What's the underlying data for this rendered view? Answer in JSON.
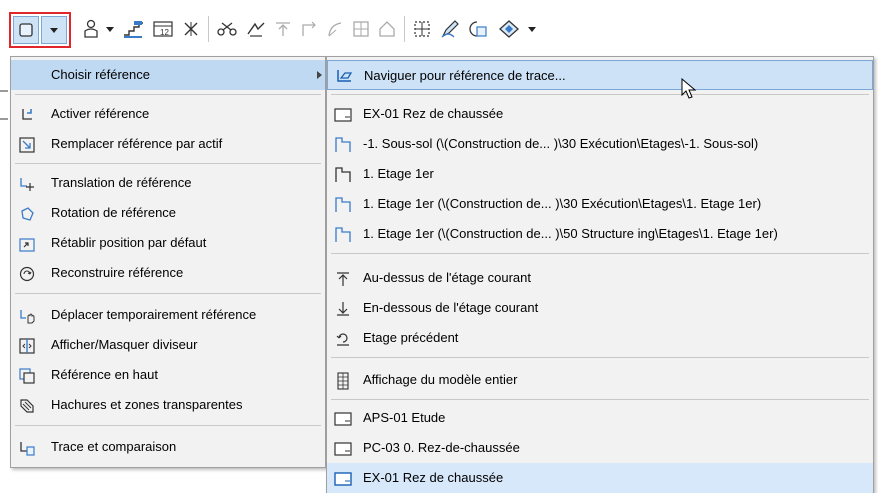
{
  "colors": {
    "accent": "#1a73e8",
    "highlight": "#cde2f7",
    "red_outline": "#e0252b"
  },
  "toolbar": {
    "icons": [
      "reference-icon",
      "dropdown-arrow",
      "person-icon",
      "dropdown-arrow",
      "stairs-icon",
      "dimension-icon",
      "close-x-icon",
      "scissors-icon",
      "trim-icon",
      "align-top-icon",
      "corner-icon",
      "curve-icon",
      "grid-box-icon",
      "house-icon",
      "grid-select-icon",
      "pen-icon",
      "tag-icon",
      "diamond-icon",
      "dropdown-arrow"
    ]
  },
  "left_menu": {
    "items": [
      {
        "label": "Choisir référence",
        "icon": "none",
        "selected": true,
        "submenu": true
      },
      {
        "label": "Activer référence",
        "icon": "activate-ref-icon"
      },
      {
        "label": "Remplacer référence par actif",
        "icon": "replace-ref-icon"
      },
      {
        "label": "Translation de référence",
        "icon": "translate-ref-icon"
      },
      {
        "label": "Rotation de référence",
        "icon": "rotate-ref-icon"
      },
      {
        "label": "Rétablir position par défaut",
        "icon": "reset-position-icon"
      },
      {
        "label": "Reconstruire référence",
        "icon": "rebuild-ref-icon"
      },
      {
        "label": "Déplacer temporairement référence",
        "icon": "move-temp-icon"
      },
      {
        "label": "Afficher/Masquer diviseur",
        "icon": "divider-icon"
      },
      {
        "label": "Référence en haut",
        "icon": "ref-top-icon"
      },
      {
        "label": "Hachures et zones transparentes",
        "icon": "hatch-icon"
      },
      {
        "label": "Trace et comparaison",
        "icon": "trace-compare-icon"
      }
    ]
  },
  "right_menu": {
    "items": [
      {
        "label": "Naviguer pour référence de trace...",
        "icon": "browse-icon",
        "highlight": true
      },
      {
        "label": "EX-01 Rez de chaussée",
        "icon": "layout-icon"
      },
      {
        "label": "-1. Sous-sol (\\(Construction de... )\\30 Exécution\\Etages\\-1. Sous-sol)",
        "icon": "story-icon"
      },
      {
        "label": "1. Etage 1er",
        "icon": "story-icon"
      },
      {
        "label": "1. Etage 1er (\\(Construction de... )\\30 Exécution\\Etages\\1. Etage 1er)",
        "icon": "story-icon"
      },
      {
        "label": "1. Etage 1er (\\(Construction de... )\\50 Structure ing\\Etages\\1. Etage 1er)",
        "icon": "story-icon"
      },
      {
        "label": "Au-dessus de l'étage courant",
        "icon": "above-icon"
      },
      {
        "label": "En-dessous de l'étage courant",
        "icon": "below-icon"
      },
      {
        "label": "Etage précédent",
        "icon": "previous-icon"
      },
      {
        "label": "Affichage du modèle entier",
        "icon": "whole-model-icon"
      },
      {
        "label": "APS-01 Etude",
        "icon": "layout-icon"
      },
      {
        "label": "PC-03 0. Rez-de-chaussée",
        "icon": "layout-icon"
      },
      {
        "label": "EX-01 Rez de chaussée",
        "icon": "layout-icon"
      }
    ]
  }
}
